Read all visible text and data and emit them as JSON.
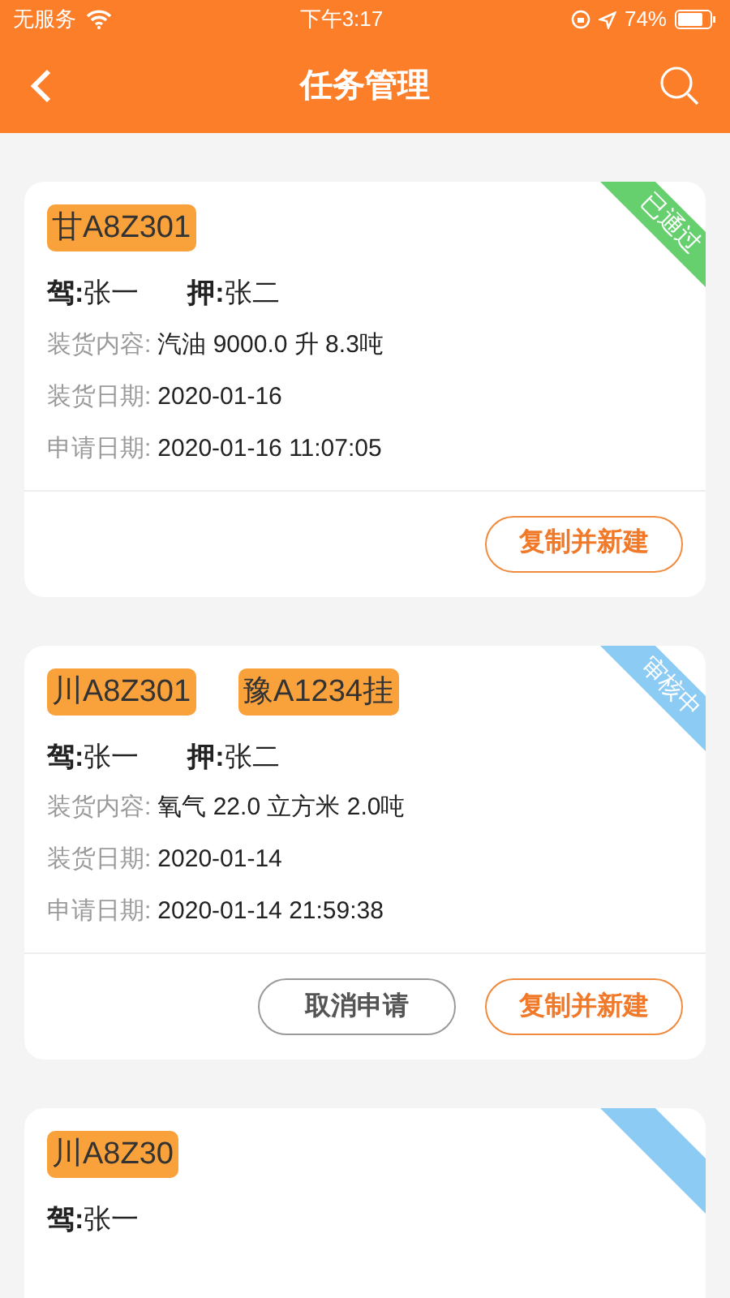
{
  "status_bar": {
    "carrier": "无服务",
    "time": "下午3:17",
    "battery": "74%"
  },
  "nav": {
    "title": "任务管理"
  },
  "tasks": [
    {
      "plates": [
        "甘A8Z301"
      ],
      "driver_label": "驾:",
      "driver": "张一",
      "escort_label": "押:",
      "escort": "张二",
      "color": "#66cf6e",
      "status": "已通过",
      "fields": [
        {
          "label": "装货内容:",
          "value": "汽油 9000.0 升 8.3吨"
        },
        {
          "label": "装货日期:",
          "value": "2020-01-16"
        },
        {
          "label": "申请日期:",
          "value": "2020-01-16 11:07:05"
        }
      ],
      "buttons": [
        {
          "kind": "copy",
          "label": "复制并新建"
        }
      ]
    },
    {
      "plates": [
        "川A8Z301",
        "豫A1234挂"
      ],
      "driver_label": "驾:",
      "driver": "张一",
      "escort_label": "押:",
      "escort": "张二",
      "color": "#8ccbf3",
      "status": "审核中",
      "fields": [
        {
          "label": "装货内容:",
          "value": "氧气 22.0 立方米 2.0吨"
        },
        {
          "label": "装货日期:",
          "value": "2020-01-14"
        },
        {
          "label": "申请日期:",
          "value": "2020-01-14 21:59:38"
        }
      ],
      "buttons": [
        {
          "kind": "cancel",
          "label": "取消申请"
        },
        {
          "kind": "copy",
          "label": "复制并新建"
        }
      ]
    },
    {
      "plates": [
        "川A8Z30"
      ],
      "driver_label": "驾:",
      "driver": "张一",
      "color": "#8ccbf3"
    }
  ]
}
